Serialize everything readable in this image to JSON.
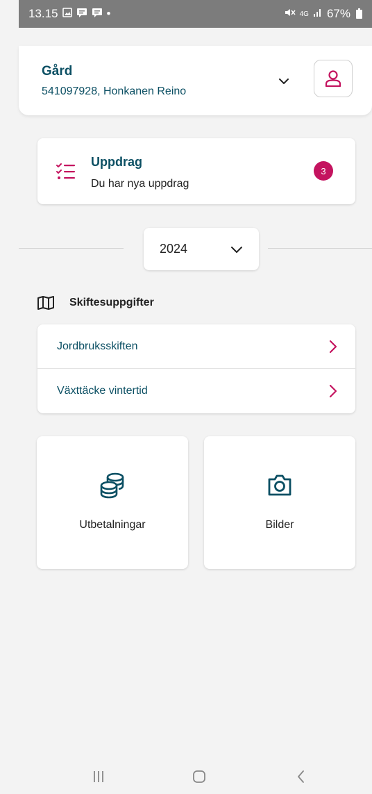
{
  "status_bar": {
    "time": "13.15",
    "notification_icons": [
      "image-icon",
      "message-icon",
      "message-icon",
      "dot-icon"
    ],
    "network": "4G",
    "battery_percent": "67%"
  },
  "farm": {
    "title": "Gård",
    "subtitle": "541097928, Honkanen Reino"
  },
  "assignments": {
    "title": "Uppdrag",
    "subtitle": "Du har nya uppdrag",
    "badge_count": "3"
  },
  "year_selector": {
    "value": "2024"
  },
  "parcels_section": {
    "title": "Skiftesuppgifter",
    "items": [
      {
        "label": "Jordbruksskiften"
      },
      {
        "label": "Växttäcke vintertid"
      }
    ]
  },
  "tiles": [
    {
      "label": "Utbetalningar",
      "icon": "coins-icon"
    },
    {
      "label": "Bilder",
      "icon": "camera-icon"
    }
  ],
  "colors": {
    "primary": "#0b4f63",
    "accent": "#c4135f",
    "background": "#f3f3f3"
  }
}
